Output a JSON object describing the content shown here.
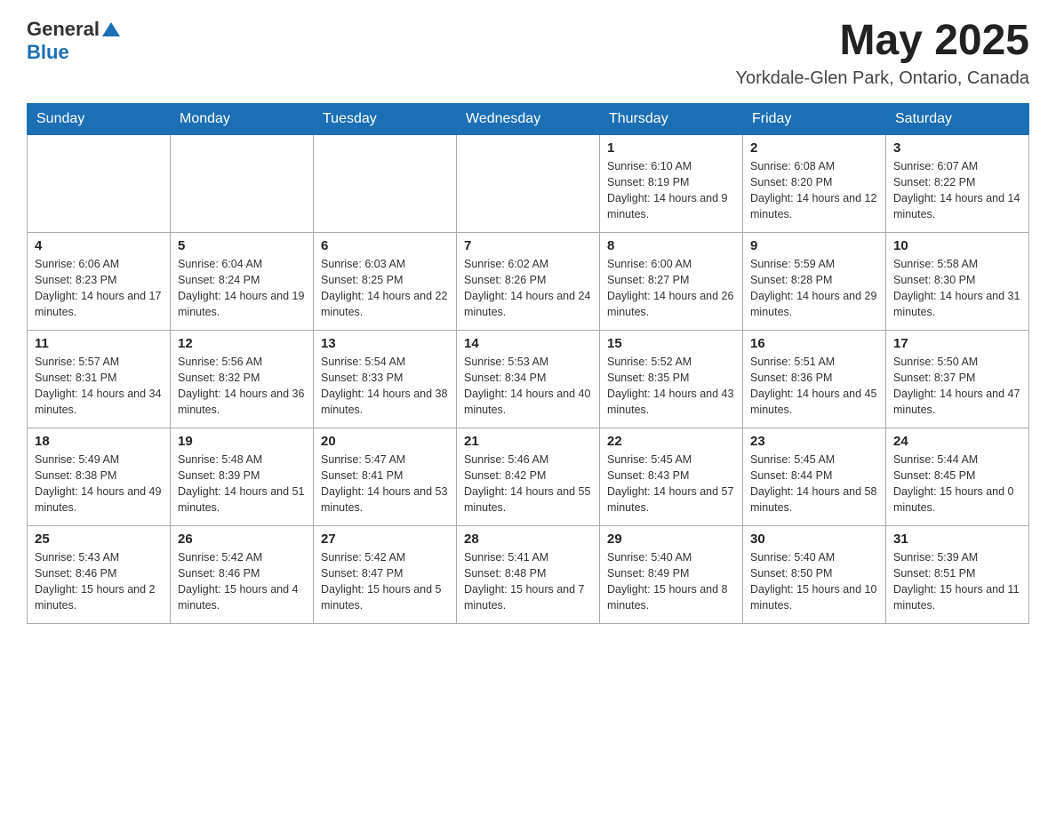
{
  "header": {
    "logo_general": "General",
    "logo_blue": "Blue",
    "month_title": "May 2025",
    "location": "Yorkdale-Glen Park, Ontario, Canada"
  },
  "weekdays": [
    "Sunday",
    "Monday",
    "Tuesday",
    "Wednesday",
    "Thursday",
    "Friday",
    "Saturday"
  ],
  "weeks": [
    [
      {
        "day": "",
        "info": ""
      },
      {
        "day": "",
        "info": ""
      },
      {
        "day": "",
        "info": ""
      },
      {
        "day": "",
        "info": ""
      },
      {
        "day": "1",
        "info": "Sunrise: 6:10 AM\nSunset: 8:19 PM\nDaylight: 14 hours and 9 minutes."
      },
      {
        "day": "2",
        "info": "Sunrise: 6:08 AM\nSunset: 8:20 PM\nDaylight: 14 hours and 12 minutes."
      },
      {
        "day": "3",
        "info": "Sunrise: 6:07 AM\nSunset: 8:22 PM\nDaylight: 14 hours and 14 minutes."
      }
    ],
    [
      {
        "day": "4",
        "info": "Sunrise: 6:06 AM\nSunset: 8:23 PM\nDaylight: 14 hours and 17 minutes."
      },
      {
        "day": "5",
        "info": "Sunrise: 6:04 AM\nSunset: 8:24 PM\nDaylight: 14 hours and 19 minutes."
      },
      {
        "day": "6",
        "info": "Sunrise: 6:03 AM\nSunset: 8:25 PM\nDaylight: 14 hours and 22 minutes."
      },
      {
        "day": "7",
        "info": "Sunrise: 6:02 AM\nSunset: 8:26 PM\nDaylight: 14 hours and 24 minutes."
      },
      {
        "day": "8",
        "info": "Sunrise: 6:00 AM\nSunset: 8:27 PM\nDaylight: 14 hours and 26 minutes."
      },
      {
        "day": "9",
        "info": "Sunrise: 5:59 AM\nSunset: 8:28 PM\nDaylight: 14 hours and 29 minutes."
      },
      {
        "day": "10",
        "info": "Sunrise: 5:58 AM\nSunset: 8:30 PM\nDaylight: 14 hours and 31 minutes."
      }
    ],
    [
      {
        "day": "11",
        "info": "Sunrise: 5:57 AM\nSunset: 8:31 PM\nDaylight: 14 hours and 34 minutes."
      },
      {
        "day": "12",
        "info": "Sunrise: 5:56 AM\nSunset: 8:32 PM\nDaylight: 14 hours and 36 minutes."
      },
      {
        "day": "13",
        "info": "Sunrise: 5:54 AM\nSunset: 8:33 PM\nDaylight: 14 hours and 38 minutes."
      },
      {
        "day": "14",
        "info": "Sunrise: 5:53 AM\nSunset: 8:34 PM\nDaylight: 14 hours and 40 minutes."
      },
      {
        "day": "15",
        "info": "Sunrise: 5:52 AM\nSunset: 8:35 PM\nDaylight: 14 hours and 43 minutes."
      },
      {
        "day": "16",
        "info": "Sunrise: 5:51 AM\nSunset: 8:36 PM\nDaylight: 14 hours and 45 minutes."
      },
      {
        "day": "17",
        "info": "Sunrise: 5:50 AM\nSunset: 8:37 PM\nDaylight: 14 hours and 47 minutes."
      }
    ],
    [
      {
        "day": "18",
        "info": "Sunrise: 5:49 AM\nSunset: 8:38 PM\nDaylight: 14 hours and 49 minutes."
      },
      {
        "day": "19",
        "info": "Sunrise: 5:48 AM\nSunset: 8:39 PM\nDaylight: 14 hours and 51 minutes."
      },
      {
        "day": "20",
        "info": "Sunrise: 5:47 AM\nSunset: 8:41 PM\nDaylight: 14 hours and 53 minutes."
      },
      {
        "day": "21",
        "info": "Sunrise: 5:46 AM\nSunset: 8:42 PM\nDaylight: 14 hours and 55 minutes."
      },
      {
        "day": "22",
        "info": "Sunrise: 5:45 AM\nSunset: 8:43 PM\nDaylight: 14 hours and 57 minutes."
      },
      {
        "day": "23",
        "info": "Sunrise: 5:45 AM\nSunset: 8:44 PM\nDaylight: 14 hours and 58 minutes."
      },
      {
        "day": "24",
        "info": "Sunrise: 5:44 AM\nSunset: 8:45 PM\nDaylight: 15 hours and 0 minutes."
      }
    ],
    [
      {
        "day": "25",
        "info": "Sunrise: 5:43 AM\nSunset: 8:46 PM\nDaylight: 15 hours and 2 minutes."
      },
      {
        "day": "26",
        "info": "Sunrise: 5:42 AM\nSunset: 8:46 PM\nDaylight: 15 hours and 4 minutes."
      },
      {
        "day": "27",
        "info": "Sunrise: 5:42 AM\nSunset: 8:47 PM\nDaylight: 15 hours and 5 minutes."
      },
      {
        "day": "28",
        "info": "Sunrise: 5:41 AM\nSunset: 8:48 PM\nDaylight: 15 hours and 7 minutes."
      },
      {
        "day": "29",
        "info": "Sunrise: 5:40 AM\nSunset: 8:49 PM\nDaylight: 15 hours and 8 minutes."
      },
      {
        "day": "30",
        "info": "Sunrise: 5:40 AM\nSunset: 8:50 PM\nDaylight: 15 hours and 10 minutes."
      },
      {
        "day": "31",
        "info": "Sunrise: 5:39 AM\nSunset: 8:51 PM\nDaylight: 15 hours and 11 minutes."
      }
    ]
  ]
}
